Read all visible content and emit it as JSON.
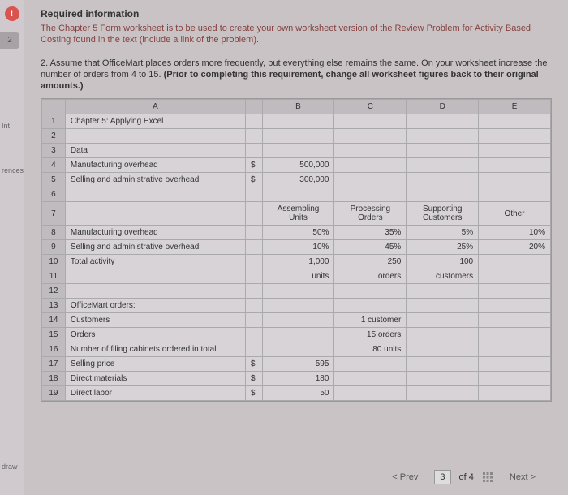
{
  "required": {
    "title": "Required information",
    "text": "The Chapter 5 Form worksheet is to be used to create your own worksheet version of the Review Problem for Activity Based Costing found in the text (include a link of the problem)."
  },
  "question": {
    "lead": "2. Assume that OfficeMart places orders more frequently, but everything else remains the same. On your worksheet increase the number of orders from 4 to 15. ",
    "bold": "(Prior to completing this requirement, change all worksheet figures back to their original amounts.)"
  },
  "sheet": {
    "cols": [
      "A",
      "B",
      "C",
      "D",
      "E"
    ],
    "rows": {
      "1": {
        "a": "Chapter 5: Applying Excel"
      },
      "2": {},
      "3": {
        "a": "Data"
      },
      "4": {
        "a": "Manufacturing overhead",
        "bd": "$",
        "b": "500,000"
      },
      "5": {
        "a": "Selling and administrative overhead",
        "bd": "$",
        "b": "300,000"
      },
      "6": {},
      "7": {
        "b": "Assembling Units",
        "c": "Processing Orders",
        "d": "Supporting Customers",
        "e": "Other"
      },
      "8": {
        "a": "Manufacturing overhead",
        "b": "50%",
        "c": "35%",
        "d": "5%",
        "e": "10%"
      },
      "9": {
        "a": "Selling and administrative overhead",
        "b": "10%",
        "c": "45%",
        "d": "25%",
        "e": "20%"
      },
      "10": {
        "a": "Total activity",
        "b": "1,000",
        "c": "250",
        "d": "100"
      },
      "11": {
        "b": "units",
        "c": "orders",
        "d": "customers"
      },
      "12": {},
      "13": {
        "a": "OfficeMart orders:"
      },
      "14": {
        "a": "Customers",
        "c": "1 customer"
      },
      "15": {
        "a": "Orders",
        "c": "15 orders"
      },
      "16": {
        "a": "Number of filing cabinets ordered in total",
        "c": "80 units"
      },
      "17": {
        "a": "Selling price",
        "bd": "$",
        "b": "595"
      },
      "18": {
        "a": "Direct materials",
        "bd": "$",
        "b": "180"
      },
      "19": {
        "a": "Direct labor",
        "bd": "$",
        "b": "50"
      }
    }
  },
  "footer": {
    "prev": "< Prev",
    "page": "3",
    "of": "of 4",
    "next": "Next >"
  },
  "sidebar": {
    "tab2": "2",
    "hint_label": "Int",
    "ref_label": "rences",
    "draw_label": "draw"
  }
}
